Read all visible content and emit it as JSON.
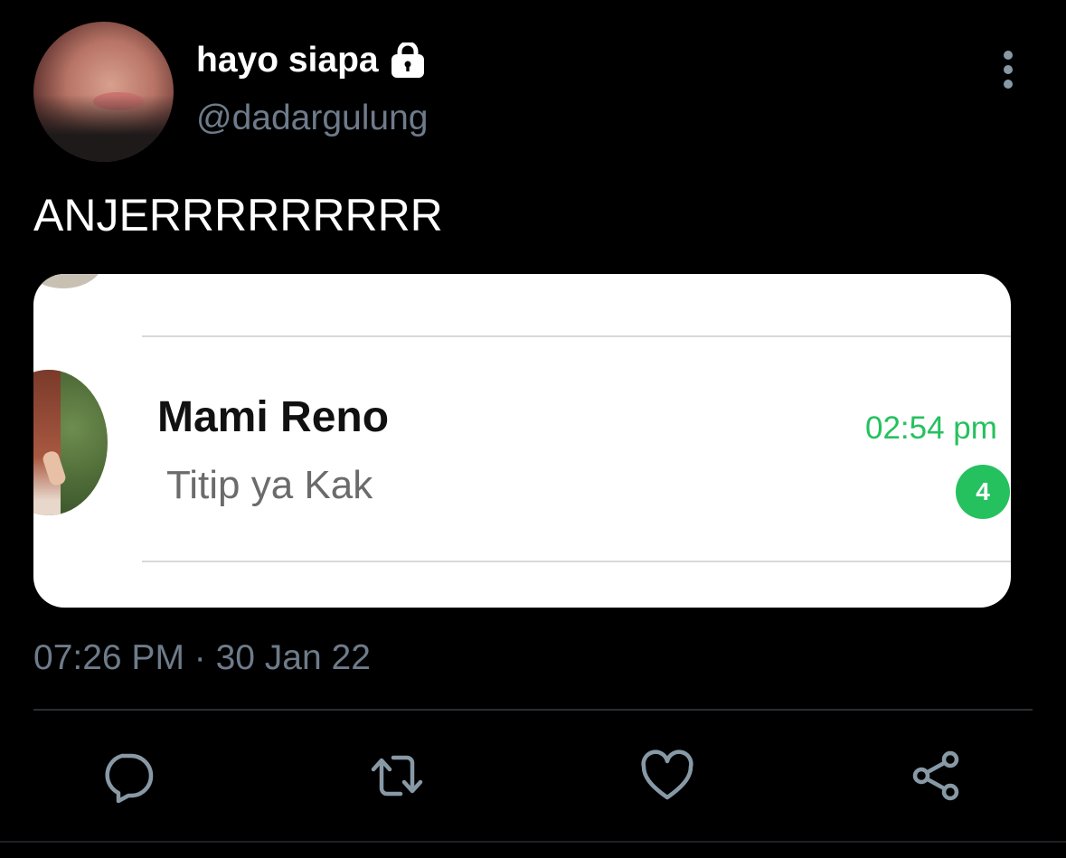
{
  "tweet": {
    "display_name": "hayo siapa",
    "handle": "@dadargulung",
    "text": "ANJERRRRRRRRR",
    "timestamp": "07:26 PM · 30 Jan 22",
    "protected": true
  },
  "media": {
    "chat_name": "Mami Reno",
    "chat_message": "Titip ya Kak",
    "chat_time": "02:54 pm",
    "unread_count": "4",
    "accent_color": "#25c15f"
  },
  "actions": {
    "icons": [
      "reply-icon",
      "retweet-icon",
      "like-icon",
      "share-icon"
    ]
  },
  "colors": {
    "background": "#000000",
    "secondary_text": "#6e7b8a",
    "primary_text": "#ffffff"
  }
}
